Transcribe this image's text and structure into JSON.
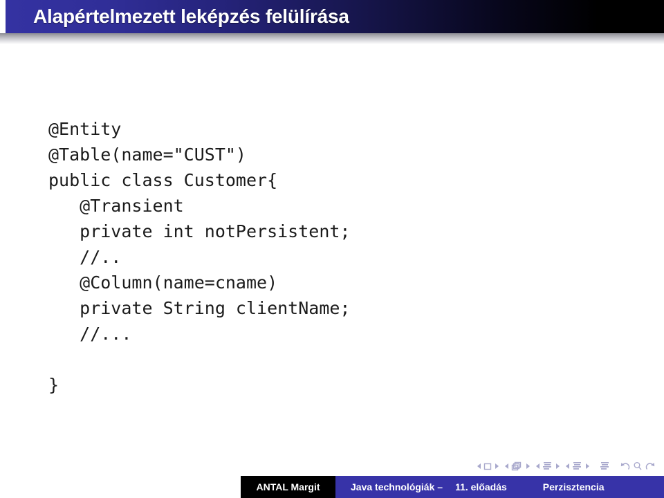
{
  "slide": {
    "title": "Alapértelmezett leképzés felülírása",
    "code_lines": [
      "@Entity",
      "@Table(name=\"CUST\")",
      "public class Customer{",
      "   @Transient",
      "   private int notPersistent;",
      "   //..",
      "   @Column(name=cname)",
      "   private String clientName;",
      "   //...",
      "",
      "}"
    ]
  },
  "navigation": {
    "icons": [
      "first-slide-icon",
      "previous-slide-icon",
      "next-slide-icon",
      "last-slide-icon",
      "first-frame-icon",
      "previous-frame-icon",
      "frame-icon",
      "next-frame-icon",
      "last-frame-icon",
      "previous-subsection-icon",
      "subsection-icon",
      "next-subsection-icon",
      "previous-section-icon",
      "section-icon",
      "next-section-icon",
      "table-of-contents-icon",
      "back-icon",
      "search-icon",
      "forward-icon"
    ]
  },
  "footer": {
    "author": "ANTAL Margit",
    "course": "Java technológiák –",
    "lecture": "11. előadás",
    "topic": "Perzisztencia"
  },
  "colors": {
    "header_blue": "#3432a2",
    "header_black": "#000000",
    "footer_blue": "#3733a8",
    "footer_black": "#000000",
    "nav_icon": "#a8a8cc",
    "code_text": "#1b1b1b"
  }
}
